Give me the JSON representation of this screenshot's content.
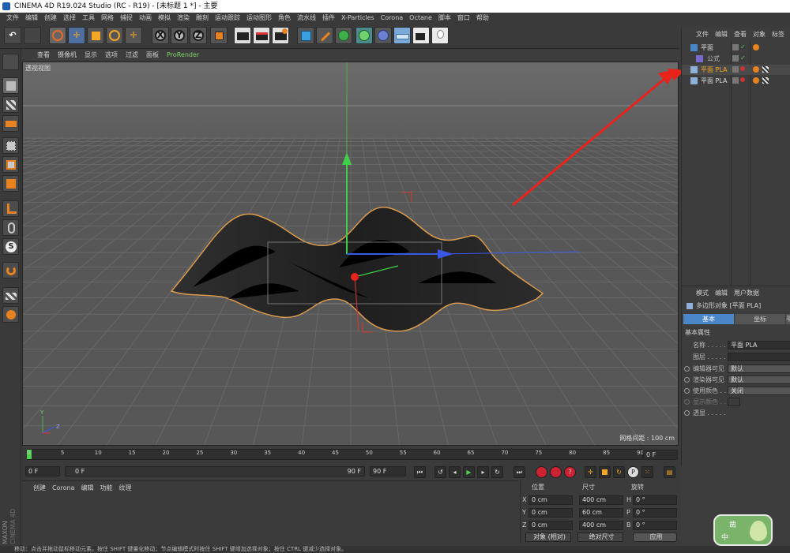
{
  "window": {
    "title": "CINEMA 4D R19.024 Studio (RC - R19) - [未标题 1 *] - 主要"
  },
  "menubar": [
    "文件",
    "编辑",
    "创建",
    "选择",
    "工具",
    "网格",
    "捕捉",
    "动画",
    "模拟",
    "渲染",
    "雕刻",
    "运动跟踪",
    "运动图形",
    "角色",
    "流水线",
    "插件",
    "X-Particles",
    "Corona",
    "Octane",
    "脚本",
    "窗口",
    "帮助"
  ],
  "toolbar": {
    "axis_x": "X",
    "axis_y": "Y",
    "axis_z": "Z",
    "icons": [
      "undo-icon",
      "redo-icon",
      "select-icon",
      "move-icon",
      "scale-icon",
      "rotate-icon",
      "recent-tool-icon",
      "coord-system-icon",
      "render-view-icon",
      "render-picture-viewer-icon",
      "render-settings-icon",
      "cube-icon",
      "pen-icon",
      "subdivision-icon",
      "cloner-icon",
      "deformer-icon",
      "floor-icon",
      "camera-icon",
      "light-icon"
    ]
  },
  "viewport": {
    "menu": [
      "查看",
      "摄像机",
      "显示",
      "选项",
      "过滤",
      "面板",
      "ProRender"
    ],
    "label": "透视视图",
    "grid_info": "网格间距 : 100 cm",
    "axis_y": "Y",
    "axis_z": "Z"
  },
  "timeline": {
    "ticks": [
      "0",
      "5",
      "10",
      "15",
      "20",
      "25",
      "30",
      "35",
      "40",
      "45",
      "50",
      "55",
      "60",
      "65",
      "70",
      "75",
      "80",
      "85",
      "90"
    ],
    "end_frame": "0 F"
  },
  "transport": {
    "start": "0 F",
    "slider_start": "0 F",
    "slider_end": "90 F",
    "end": "90 F"
  },
  "materials": {
    "menu": [
      "创建",
      "Corona",
      "编辑",
      "功能",
      "纹理"
    ],
    "brand_1": "MAXON",
    "brand_2": "CINEMA 4D"
  },
  "coordinates": {
    "headers": [
      "位置",
      "尺寸",
      "旋转"
    ],
    "rows": [
      {
        "axis": "X",
        "pos": "0 cm",
        "size": "400 cm",
        "rot_axis": "H",
        "rot": "0 °"
      },
      {
        "axis": "Y",
        "pos": "0 cm",
        "size": "60 cm",
        "rot_axis": "P",
        "rot": "0 °"
      },
      {
        "axis": "Z",
        "pos": "0 cm",
        "size": "400 cm",
        "rot_axis": "B",
        "rot": "0 °"
      }
    ],
    "mode": "对象 (相对)",
    "size_mode": "绝对尺寸",
    "apply": "应用"
  },
  "object_manager": {
    "menu": [
      "文件",
      "编辑",
      "查看",
      "对象",
      "标签"
    ],
    "objects": [
      {
        "name": "平面",
        "indent": 0,
        "selected": false
      },
      {
        "name": "公式",
        "indent": 1,
        "selected": false
      },
      {
        "name": "平面 PLA",
        "indent": 0,
        "selected": true
      },
      {
        "name": "平面 PLA",
        "indent": 0,
        "selected": false
      }
    ]
  },
  "attribute_manager": {
    "menu": [
      "模式",
      "编辑",
      "用户数据"
    ],
    "title": "多边形对象 [平面 PLA]",
    "tabs": [
      "基本",
      "坐标",
      "平"
    ],
    "section": "基本属性",
    "fields": [
      {
        "label": "名称 . . . . .",
        "value": "平面 PLA"
      },
      {
        "label": "图层 . . . . .",
        "value": ""
      },
      {
        "label": "编辑器可见",
        "value": "默认"
      },
      {
        "label": "渲染器可见",
        "value": "默认"
      },
      {
        "label": "使用颜色 . .",
        "value": "关闭"
      },
      {
        "label": "显示颜色 . .",
        "value": ""
      },
      {
        "label": "透显 . . . . .",
        "value": ""
      }
    ]
  },
  "statusbar": {
    "text": "移动：点击并拖动鼠标移动元素。按住 SHIFT 键量化移动；节点编辑模式时按住 SHIFT 键增加选择对象；按住 CTRL 键减少选择对象。"
  },
  "watermark": {
    "line1": "凿",
    "line2": "中"
  },
  "colors": {
    "accent_blue": "#4b86c8",
    "annotation_red": "#e8231c",
    "surface_edge": "#e09a4a"
  }
}
